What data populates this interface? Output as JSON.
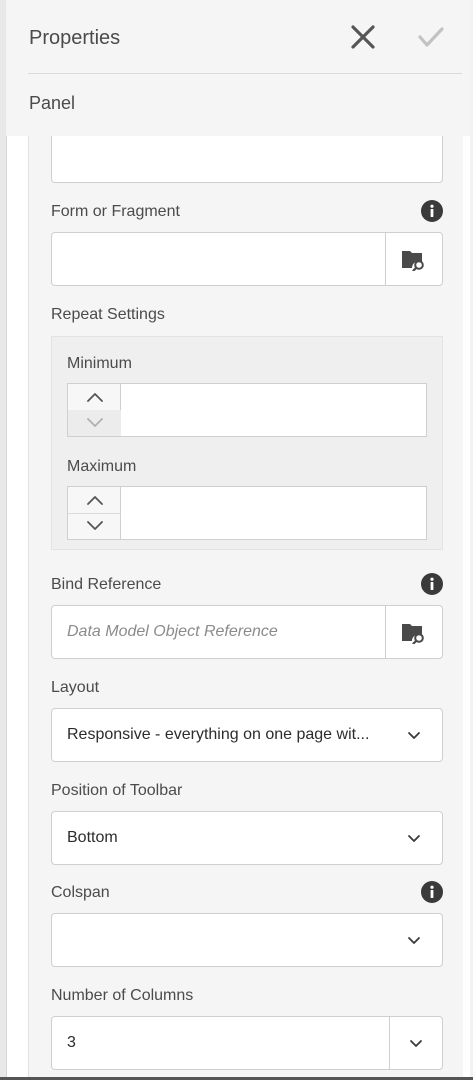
{
  "header": {
    "title": "Properties",
    "close_icon": "close-icon",
    "confirm_icon": "checkmark-icon"
  },
  "panel": {
    "label": "Panel"
  },
  "fields": {
    "form_fragment": {
      "label": "Form or Fragment",
      "value": "",
      "info_icon": "info-icon",
      "browse_icon": "folder-search-icon"
    },
    "repeat_settings": {
      "label": "Repeat Settings",
      "minimum": {
        "label": "Minimum",
        "value": ""
      },
      "maximum": {
        "label": "Maximum",
        "value": ""
      }
    },
    "bind_reference": {
      "label": "Bind Reference",
      "placeholder": "Data Model Object Reference",
      "info_icon": "info-icon",
      "browse_icon": "folder-search-icon"
    },
    "layout": {
      "label": "Layout",
      "selected": "Responsive - everything on one page wit..."
    },
    "toolbar_position": {
      "label": "Position of Toolbar",
      "selected": "Bottom"
    },
    "colspan": {
      "label": "Colspan",
      "selected": ""
    },
    "columns": {
      "label": "Number of Columns",
      "value": "3"
    }
  },
  "colors": {
    "panel_bg": "#f5f5f5",
    "text": "#4b4b4b",
    "icon": "#3a3a3a",
    "border": "#cfcfcf"
  }
}
